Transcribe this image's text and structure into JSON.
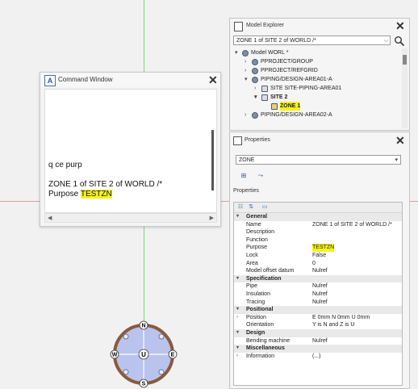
{
  "command_window": {
    "title": "Command Window",
    "lines": [
      "q ce purp",
      "ZONE 1 of SITE 2 of WORLD /*"
    ],
    "purpose_label": "Purpose",
    "purpose_value": "TESTZN"
  },
  "model_explorer": {
    "title": "Model Explorer",
    "selector": "ZONE 1 of SITE 2 of WORLD /*",
    "tree": [
      {
        "label": "Model WORL *",
        "toggle": "▾"
      },
      {
        "label": "PPROJECT/GROUP",
        "toggle": "›"
      },
      {
        "label": "PPROJECT/REFGRID",
        "toggle": "›"
      },
      {
        "label": "PIPING/DESIGN-AREA01-A",
        "toggle": "▾"
      },
      {
        "label": "SITE SITE-PIPING-AREA01",
        "toggle": "›"
      },
      {
        "label": "SITE 2",
        "toggle": "▾"
      },
      {
        "label": "ZONE 1",
        "toggle": ""
      },
      {
        "label": "PIPING/DESIGN-AREA02-A",
        "toggle": "›"
      }
    ]
  },
  "properties": {
    "title": "Properties",
    "type_selector": "ZONE",
    "tab": "Properties",
    "rows": [
      {
        "kind": "cat",
        "label": "General",
        "toggle": "▾"
      },
      {
        "kind": "prop",
        "label": "Name",
        "value": "ZONE 1 of SITE 2 of WORLD /*"
      },
      {
        "kind": "prop",
        "label": "Description",
        "value": ""
      },
      {
        "kind": "prop",
        "label": "Function",
        "value": ""
      },
      {
        "kind": "prop",
        "label": "Purpose",
        "value": "TESTZN",
        "highlight": true
      },
      {
        "kind": "prop",
        "label": "Lock",
        "value": "False"
      },
      {
        "kind": "prop",
        "label": "Area",
        "value": "0"
      },
      {
        "kind": "prop",
        "label": "Model offset datum",
        "value": "Nulref"
      },
      {
        "kind": "cat",
        "label": "Specification",
        "toggle": "▾"
      },
      {
        "kind": "prop",
        "label": "Pipe",
        "value": "Nulref"
      },
      {
        "kind": "prop",
        "label": "Insulation",
        "value": "Nulref"
      },
      {
        "kind": "prop",
        "label": "Tracing",
        "value": "Nulref"
      },
      {
        "kind": "cat",
        "label": "Positional",
        "toggle": "▾"
      },
      {
        "kind": "prop",
        "label": "Position",
        "value": "E 0mm N 0mm U 0mm",
        "toggle": "›"
      },
      {
        "kind": "prop",
        "label": "Orientation",
        "value": "Y is N and Z is U"
      },
      {
        "kind": "cat",
        "label": "Design",
        "toggle": "▾"
      },
      {
        "kind": "prop",
        "label": "Bending machine",
        "value": "Nulref"
      },
      {
        "kind": "cat",
        "label": "Miscellaneous",
        "toggle": "▾"
      },
      {
        "kind": "prop",
        "label": "Information",
        "value": "(...)",
        "toggle": "›"
      }
    ]
  },
  "compass": {
    "n": "N",
    "s": "S",
    "e": "E",
    "w": "W",
    "u": "U"
  },
  "colors": {
    "highlight": "#f7f31a",
    "compass_ring": "#8b5a3c",
    "compass_fill": "#b9c3ee"
  }
}
